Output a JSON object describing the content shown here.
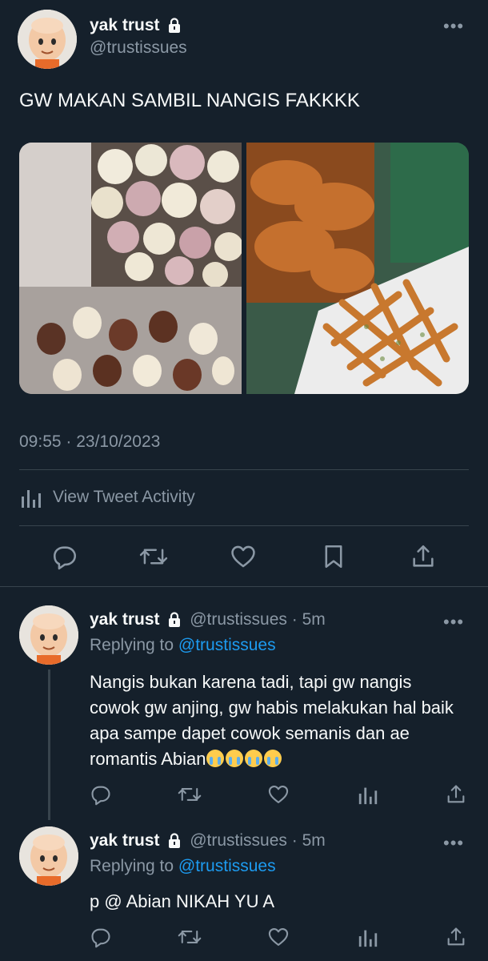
{
  "tweet": {
    "name": "yak trust",
    "handle": "@trustissues",
    "more": "•••",
    "text": "GW MAKAN SAMBIL NANGIS FAKKKK",
    "timestamp": "09:55 · 23/10/2023",
    "activity_label": "View Tweet Activity"
  },
  "replies": [
    {
      "name": "yak trust",
      "handle": "@trustissues",
      "age": "· 5m",
      "replying_prefix": "Replying to ",
      "replying_to": "@trustissues",
      "text": "Nangis bukan karena tadi, tapi gw nangis cowok gw anjing, gw habis melakukan hal baik apa sampe dapet cowok semanis dan ae romantis Abian",
      "more": "•••"
    },
    {
      "name": "yak trust",
      "handle": "@trustissues",
      "age": "· 5m",
      "replying_prefix": "Replying to ",
      "replying_to": "@trustissues",
      "text": "p @ Abian NIKAH YU A",
      "more": "•••"
    }
  ],
  "colors": {
    "background": "#15202b",
    "accent": "#1d9bf0",
    "muted": "#8b98a5",
    "divider": "#38444d"
  },
  "icons": [
    "reply-icon",
    "retweet-icon",
    "like-icon",
    "bookmark-icon",
    "share-icon",
    "analytics-icon",
    "lock-icon"
  ]
}
